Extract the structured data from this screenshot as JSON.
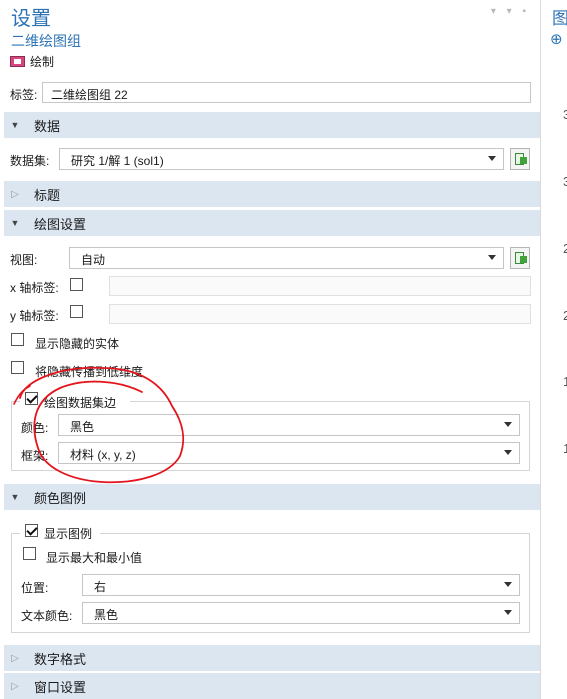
{
  "header": {
    "title": "设置",
    "subtitle": "二维绘图组",
    "plot_label": "绘制"
  },
  "label_field": {
    "label": "标签:",
    "value": "二维绘图组 22"
  },
  "sections": {
    "data": "数据",
    "title": "标题",
    "plot_settings": "绘图设置",
    "color_legend": "颜色图例",
    "number_format": "数字格式",
    "window_settings": "窗口设置"
  },
  "data_section": {
    "dataset_label": "数据集:",
    "dataset_value": "研究 1/解 1 (sol1)"
  },
  "plot_settings": {
    "view_label": "视图:",
    "view_value": "自动",
    "x_axis_label": "x 轴标签:",
    "y_axis_label": "y 轴标签:",
    "show_hidden": "显示隐藏的实体",
    "propagate_hidden": "将隐藏传播到低维度",
    "plot_dataset_edges": "绘图数据集边",
    "color_label": "颜色:",
    "color_value": "黑色",
    "frame_label": "框架:",
    "frame_value": "材料  (x, y, z)"
  },
  "legend": {
    "show_legend": "显示图例",
    "show_minmax": "显示最大和最小值",
    "position_label": "位置:",
    "position_value": "右",
    "text_color_label": "文本颜色:",
    "text_color_value": "黑色"
  },
  "right_panel": {
    "title_char": "图",
    "tick_chars": [
      "3",
      "3",
      "2",
      "2",
      "1",
      "1"
    ]
  }
}
